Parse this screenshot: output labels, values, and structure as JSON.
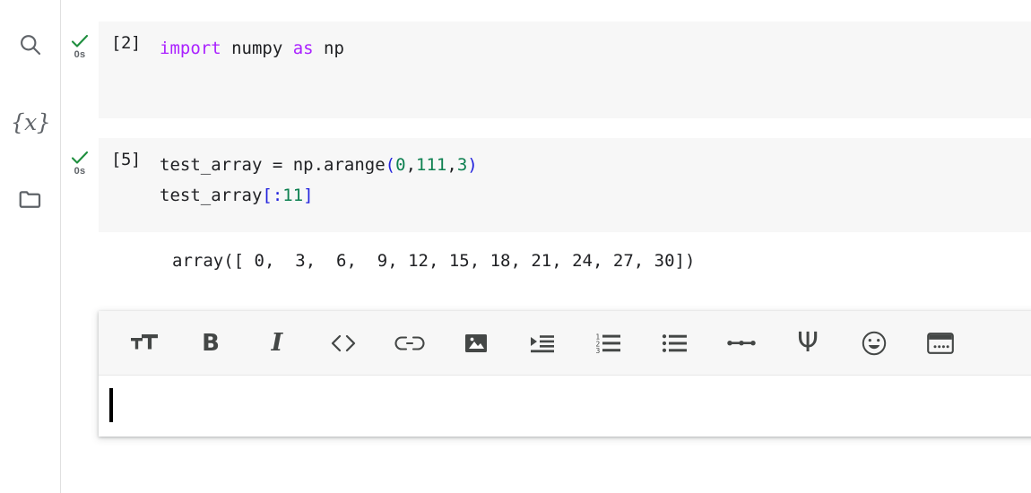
{
  "sidebar": {
    "items": [
      {
        "name": "search",
        "icon": "search-icon",
        "label": "Search"
      },
      {
        "name": "variables",
        "icon": "variables-icon",
        "label": "{x}"
      },
      {
        "name": "files",
        "icon": "folder-icon",
        "label": "Files"
      }
    ]
  },
  "notebook": {
    "cells": [
      {
        "exec_count": "[2]",
        "status_icon": "check-icon",
        "elapsed": "0s",
        "lines": [
          [
            {
              "t": "import",
              "c": "kw"
            },
            {
              "t": " numpy ",
              "c": ""
            },
            {
              "t": "as",
              "c": "kw"
            },
            {
              "t": " np",
              "c": ""
            }
          ]
        ],
        "output": null
      },
      {
        "exec_count": "[5]",
        "status_icon": "check-icon",
        "elapsed": "0s",
        "lines": [
          [
            {
              "t": "test_array = np.arange",
              "c": ""
            },
            {
              "t": "(",
              "c": "pun"
            },
            {
              "t": "0",
              "c": "num"
            },
            {
              "t": ",",
              "c": ""
            },
            {
              "t": "111",
              "c": "num"
            },
            {
              "t": ",",
              "c": ""
            },
            {
              "t": "3",
              "c": "num"
            },
            {
              "t": ")",
              "c": "pun"
            }
          ],
          [
            {
              "t": "test_array",
              "c": ""
            },
            {
              "t": "[:",
              "c": "pun"
            },
            {
              "t": "11",
              "c": "num"
            },
            {
              "t": "]",
              "c": "pun"
            }
          ]
        ],
        "output": "array([ 0,  3,  6,  9, 12, 15, 18, 21, 24, 27, 30])"
      }
    ]
  },
  "markdown_editor": {
    "toolbar_buttons": [
      {
        "name": "text-size-button",
        "icon": "text-size-icon"
      },
      {
        "name": "bold-button",
        "icon": "bold-icon",
        "glyph": "B"
      },
      {
        "name": "italic-button",
        "icon": "italic-icon",
        "glyph": "I"
      },
      {
        "name": "code-button",
        "icon": "code-brackets-icon",
        "glyph": "<>"
      },
      {
        "name": "link-button",
        "icon": "link-icon"
      },
      {
        "name": "image-button",
        "icon": "image-icon"
      },
      {
        "name": "indent-button",
        "icon": "indent-increase-icon"
      },
      {
        "name": "numbered-list-button",
        "icon": "numbered-list-icon"
      },
      {
        "name": "bulleted-list-button",
        "icon": "bulleted-list-icon"
      },
      {
        "name": "horizontal-rule-button",
        "icon": "horizontal-rule-icon"
      },
      {
        "name": "latex-button",
        "icon": "latex-psi-icon",
        "glyph": "Ψ"
      },
      {
        "name": "emoji-button",
        "icon": "emoji-smiley-icon"
      },
      {
        "name": "widget-button",
        "icon": "window-dots-icon"
      }
    ],
    "editor_value": "",
    "editor_placeholder": ""
  },
  "colors": {
    "keyword": "#aa22ff",
    "number": "#0d8050",
    "punctuation": "#2222dd",
    "text": "#202124",
    "cell_bg": "#f7f7f7",
    "status_check": "#1e8e3e",
    "icon": "#5f6368"
  }
}
